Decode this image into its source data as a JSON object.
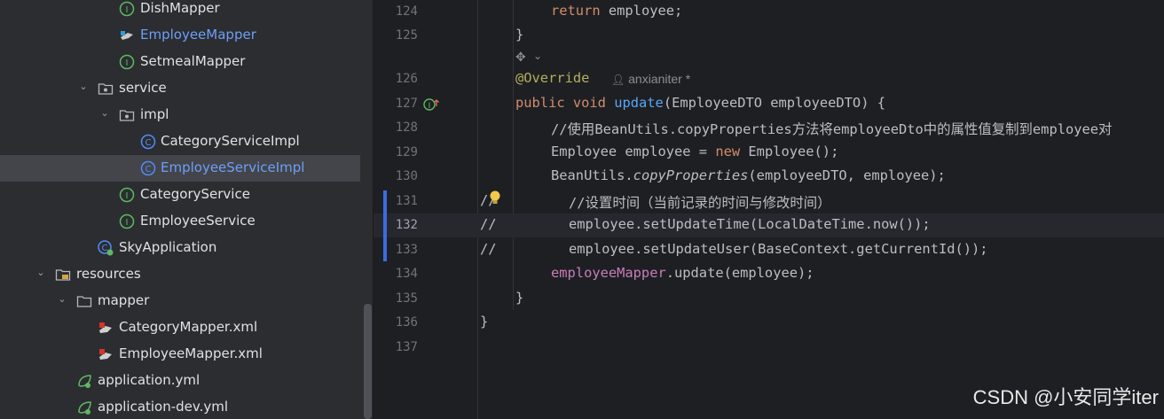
{
  "tree": {
    "items": [
      {
        "label": "DishMapper"
      },
      {
        "label": "EmployeeMapper"
      },
      {
        "label": "SetmealMapper"
      },
      {
        "label": "service"
      },
      {
        "label": "impl"
      },
      {
        "label": "CategoryServiceImpl"
      },
      {
        "label": "EmployeeServiceImpl"
      },
      {
        "label": "CategoryService"
      },
      {
        "label": "EmployeeService"
      },
      {
        "label": "SkyApplication"
      },
      {
        "label": "resources"
      },
      {
        "label": "mapper"
      },
      {
        "label": "CategoryMapper.xml"
      },
      {
        "label": "EmployeeMapper.xml"
      },
      {
        "label": "application.yml"
      },
      {
        "label": "application-dev.yml"
      }
    ]
  },
  "editor": {
    "author_hint": "anxianiter *",
    "lines": [
      {
        "num": "124"
      },
      {
        "num": "125"
      },
      {
        "num": "126"
      },
      {
        "num": "127"
      },
      {
        "num": "128"
      },
      {
        "num": "129"
      },
      {
        "num": "130"
      },
      {
        "num": "131"
      },
      {
        "num": "132"
      },
      {
        "num": "133"
      },
      {
        "num": "134"
      },
      {
        "num": "135"
      },
      {
        "num": "136"
      },
      {
        "num": "137"
      }
    ],
    "code": {
      "l124_kw": "return",
      "l124_rest": " employee;",
      "l125": "}",
      "l126": "@Override",
      "l127_kw": "public void ",
      "l127_fn": "update",
      "l127_rest": "(EmployeeDTO employeeDTO) {",
      "l128": "//使用BeanUtils.copyProperties方法将employeeDto中的属性值复制到employee对",
      "l129_a": "Employee employee = ",
      "l129_kw": "new",
      "l129_b": " Employee();",
      "l130_a": "BeanUtils.",
      "l130_it": "copyProperties",
      "l130_b": "(employeeDTO, employee);",
      "l131_pre": "//",
      "l131": "//设置时间（当前记录的时间与修改时间）",
      "l132_pre": "//",
      "l132": "employee.setUpdateTime(LocalDateTime.now());",
      "l133_pre": "//",
      "l133": "employee.setUpdateUser(BaseContext.getCurrentId());",
      "l134_fld": "employeeMapper",
      "l134_rest": ".update(employee);",
      "l135": "}",
      "l136": "}"
    }
  },
  "watermark": "CSDN @小安同学iter",
  "colors": {
    "tree_bg": "#2b2d30",
    "editor_bg": "#1e1f22",
    "keyword": "#cf8e6d",
    "method": "#56a8f5",
    "field": "#c77dbb",
    "annotation": "#b3ae60",
    "selection": "#43454a",
    "change_marker": "#3d6be0"
  }
}
